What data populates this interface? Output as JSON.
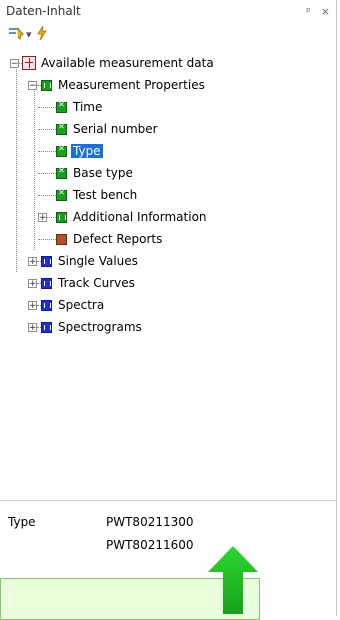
{
  "panel": {
    "title": "Daten-Inhalt",
    "pin_label": "ᵖ"
  },
  "tree": {
    "root": "Available measurement data",
    "measurement_properties": "Measurement Properties",
    "children": [
      {
        "label": "Time",
        "icon": "green-check-icon"
      },
      {
        "label": "Serial number",
        "icon": "green-check-icon"
      },
      {
        "label": "Type",
        "icon": "green-check-icon",
        "selected": true
      },
      {
        "label": "Base type",
        "icon": "green-check-icon"
      },
      {
        "label": "Test bench",
        "icon": "green-check-icon"
      },
      {
        "label": "Additional Information",
        "icon": "green-folder-icon",
        "expandable": true
      },
      {
        "label": "Defect Reports",
        "icon": "defect-icon"
      }
    ],
    "top_level": [
      {
        "label": "Single Values"
      },
      {
        "label": "Track Curves"
      },
      {
        "label": "Spectra"
      },
      {
        "label": "Spectrograms"
      }
    ]
  },
  "details": {
    "field_name": "Type",
    "values": [
      "PWT80211300",
      "PWT80211600"
    ]
  },
  "colors": {
    "selection": "#1a6fdc",
    "green_icon": "#17a01c",
    "blue_icon": "#1d2ee0",
    "callout_bg": "#eaffdc",
    "arrow": "#2fcf33"
  }
}
